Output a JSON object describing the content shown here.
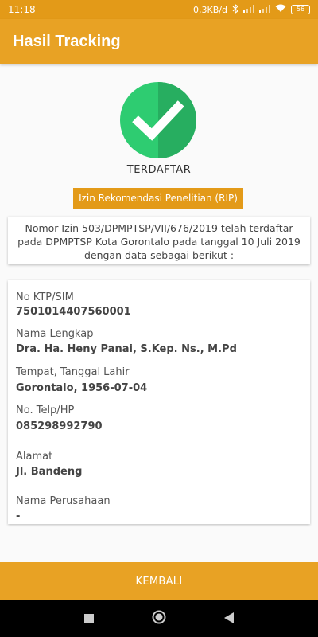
{
  "status_bar": {
    "time": "11:18",
    "speed": "0,3KB/d",
    "battery": "56"
  },
  "app": {
    "title": "Hasil Tracking"
  },
  "result": {
    "status": "TERDAFTAR",
    "permit_type": "Izin Rekomendasi Penelitian (RIP)",
    "message": "Nomor Izin 503/DPMPTSP/VII/676/2019 telah terdaftar pada DPMPTSP Kota Gorontalo pada tanggal 10 Juli 2019 dengan data sebagai berikut :"
  },
  "fields": [
    {
      "label": "No KTP/SIM",
      "value": "7501014407560001"
    },
    {
      "label": "Nama Lengkap",
      "value": "Dra. Ha. Heny Panai, S.Kep. Ns., M.Pd"
    },
    {
      "label": "Tempat, Tanggal Lahir",
      "value": "Gorontalo, 1956-07-04"
    },
    {
      "label": "No. Telp/HP",
      "value": "085298992790"
    },
    {
      "label": "Alamat",
      "value": "Jl. Bandeng"
    },
    {
      "label": "Nama Perusahaan",
      "value": "-"
    }
  ],
  "actions": {
    "back_label": "KEMBALI"
  },
  "colors": {
    "primary": "#e8a224",
    "success": "#2ecc71"
  },
  "icons": [
    "check-icon",
    "wifi-icon",
    "signal-icon",
    "bluetooth-icon",
    "battery-icon",
    "recents-icon",
    "home-icon",
    "back-icon"
  ]
}
